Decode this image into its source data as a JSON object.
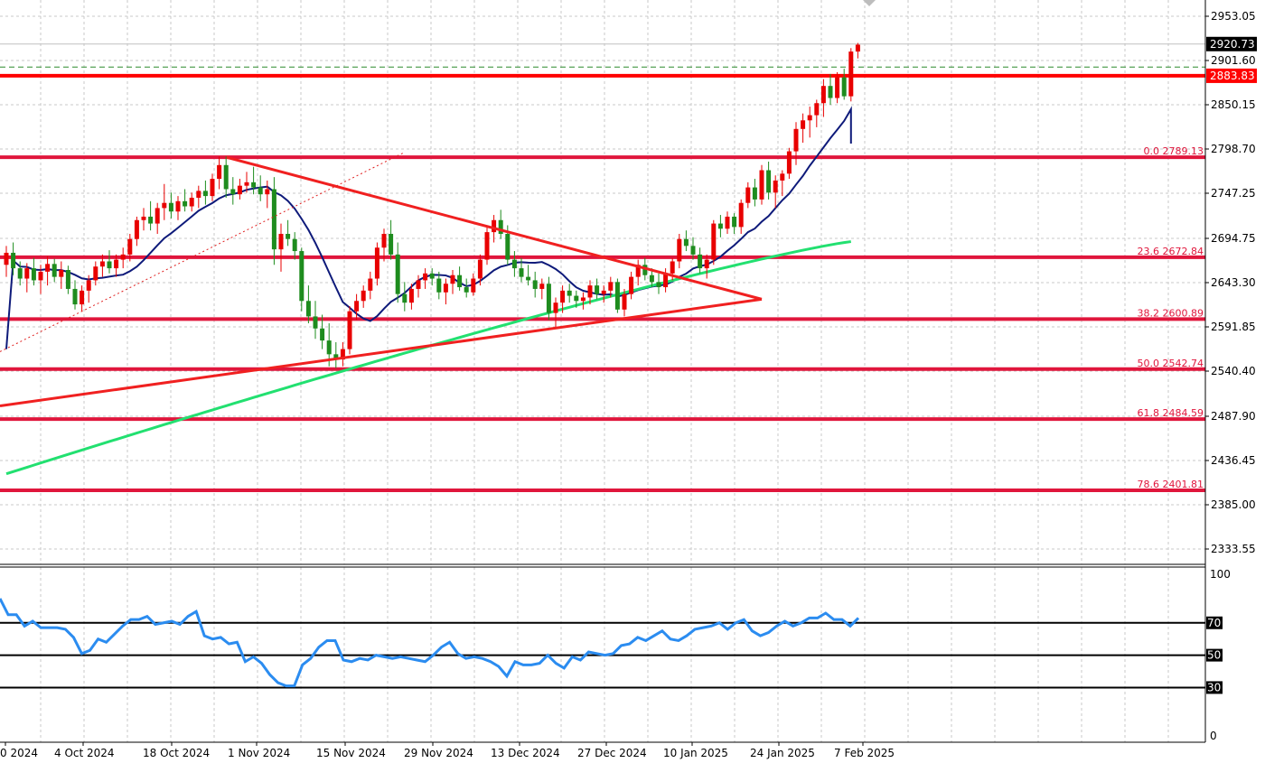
{
  "colors": {
    "background": "#ffffff",
    "grid": "#c8c8c8",
    "bull_candle": "#e80000",
    "bear_candle": "#1e8c1e",
    "fib_line": "#e0163c",
    "level_line": "#ff0000",
    "trend_line": "#f02020",
    "ma_fast": "#0e1a7a",
    "ma_slow": "#22e070",
    "rsi_line": "#2b8cf0",
    "rsi_level": "#000000"
  },
  "chart_data": [
    {
      "type": "candlestick",
      "title": "",
      "price_axis": {
        "ticks": [
          "2953.05",
          "2901.60",
          "2850.15",
          "2798.70",
          "2747.25",
          "2694.75",
          "2643.30",
          "2591.85",
          "2540.40",
          "2487.90",
          "2436.45",
          "2385.00",
          "2333.55"
        ],
        "range": [
          2322,
          2968
        ]
      },
      "time_axis": {
        "ticks": [
          "0 2024",
          "4 Oct 2024",
          "18 Oct 2024",
          "1 Nov 2024",
          "15 Nov 2024",
          "29 Nov 2024",
          "13 Dec 2024",
          "27 Dec 2024",
          "10 Jan 2025",
          "24 Jan 2025",
          "7 Feb 2025"
        ]
      },
      "current_price": {
        "label": "2920.73",
        "value": 2920.73
      },
      "ask_price": {
        "value": 2894
      },
      "horizontal_level": {
        "label": "2883.83",
        "value": 2883.83
      },
      "fibonacci_levels": [
        {
          "label": "0.0 2789.13",
          "value": 2789.13
        },
        {
          "label": "23.6 2672.84",
          "value": 2672.84
        },
        {
          "label": "38.2 2600.89",
          "value": 2600.89
        },
        {
          "label": "50.0 2542.74",
          "value": 2542.74
        },
        {
          "label": "61.8 2484.59",
          "value": 2484.59
        },
        {
          "label": "78.6 2401.81",
          "value": 2401.81
        }
      ],
      "trendlines": [
        {
          "from": [
            0,
            2500
          ],
          "to": [
            110,
            2624
          ]
        },
        {
          "from": [
            33,
            2789
          ],
          "to": [
            110,
            2624
          ]
        }
      ],
      "candles": [
        [
          2664,
          2686,
          2650,
          2678
        ],
        [
          2678,
          2690,
          2652,
          2660
        ],
        [
          2660,
          2668,
          2640,
          2648
        ],
        [
          2648,
          2666,
          2632,
          2660
        ],
        [
          2660,
          2672,
          2640,
          2646
        ],
        [
          2646,
          2664,
          2630,
          2656
        ],
        [
          2656,
          2674,
          2640,
          2665
        ],
        [
          2665,
          2671,
          2644,
          2650
        ],
        [
          2650,
          2668,
          2636,
          2658
        ],
        [
          2658,
          2663,
          2630,
          2636
        ],
        [
          2636,
          2646,
          2612,
          2618
        ],
        [
          2618,
          2640,
          2610,
          2634
        ],
        [
          2634,
          2652,
          2620,
          2646
        ],
        [
          2646,
          2668,
          2640,
          2662
        ],
        [
          2662,
          2676,
          2650,
          2668
        ],
        [
          2668,
          2681,
          2654,
          2660
        ],
        [
          2660,
          2676,
          2650,
          2670
        ],
        [
          2670,
          2684,
          2660,
          2676
        ],
        [
          2676,
          2700,
          2668,
          2694
        ],
        [
          2694,
          2720,
          2686,
          2716
        ],
        [
          2716,
          2730,
          2704,
          2720
        ],
        [
          2720,
          2738,
          2704,
          2712
        ],
        [
          2712,
          2736,
          2700,
          2730
        ],
        [
          2730,
          2758,
          2716,
          2736
        ],
        [
          2736,
          2748,
          2718,
          2726
        ],
        [
          2726,
          2744,
          2716,
          2738
        ],
        [
          2738,
          2752,
          2726,
          2732
        ],
        [
          2732,
          2748,
          2726,
          2742
        ],
        [
          2742,
          2756,
          2730,
          2750
        ],
        [
          2750,
          2762,
          2734,
          2744
        ],
        [
          2744,
          2770,
          2738,
          2764
        ],
        [
          2764,
          2790,
          2752,
          2780
        ],
        [
          2780,
          2790,
          2742,
          2752
        ],
        [
          2752,
          2766,
          2734,
          2746
        ],
        [
          2746,
          2764,
          2740,
          2756
        ],
        [
          2756,
          2772,
          2748,
          2760
        ],
        [
          2760,
          2778,
          2746,
          2754
        ],
        [
          2754,
          2768,
          2738,
          2746
        ],
        [
          2746,
          2762,
          2730,
          2752
        ],
        [
          2752,
          2766,
          2664,
          2682
        ],
        [
          2682,
          2712,
          2656,
          2700
        ],
        [
          2700,
          2716,
          2686,
          2694
        ],
        [
          2694,
          2702,
          2670,
          2680
        ],
        [
          2680,
          2684,
          2610,
          2622
        ],
        [
          2622,
          2640,
          2596,
          2604
        ],
        [
          2604,
          2622,
          2578,
          2590
        ],
        [
          2590,
          2606,
          2566,
          2576
        ],
        [
          2576,
          2596,
          2546,
          2560
        ],
        [
          2560,
          2574,
          2544,
          2554
        ],
        [
          2554,
          2574,
          2546,
          2566
        ],
        [
          2566,
          2616,
          2560,
          2610
        ],
        [
          2610,
          2630,
          2600,
          2622
        ],
        [
          2622,
          2640,
          2614,
          2634
        ],
        [
          2634,
          2656,
          2624,
          2648
        ],
        [
          2648,
          2690,
          2640,
          2684
        ],
        [
          2684,
          2706,
          2668,
          2700
        ],
        [
          2700,
          2716,
          2670,
          2676
        ],
        [
          2676,
          2690,
          2620,
          2630
        ],
        [
          2630,
          2644,
          2610,
          2620
        ],
        [
          2620,
          2642,
          2612,
          2636
        ],
        [
          2636,
          2652,
          2626,
          2646
        ],
        [
          2646,
          2660,
          2636,
          2654
        ],
        [
          2654,
          2660,
          2640,
          2648
        ],
        [
          2648,
          2656,
          2624,
          2632
        ],
        [
          2632,
          2648,
          2618,
          2642
        ],
        [
          2642,
          2658,
          2630,
          2652
        ],
        [
          2652,
          2662,
          2634,
          2638
        ],
        [
          2638,
          2648,
          2626,
          2632
        ],
        [
          2632,
          2654,
          2628,
          2648
        ],
        [
          2648,
          2676,
          2640,
          2670
        ],
        [
          2670,
          2708,
          2664,
          2702
        ],
        [
          2702,
          2722,
          2690,
          2716
        ],
        [
          2716,
          2728,
          2694,
          2700
        ],
        [
          2700,
          2710,
          2664,
          2670
        ],
        [
          2670,
          2680,
          2650,
          2660
        ],
        [
          2660,
          2672,
          2644,
          2650
        ],
        [
          2650,
          2664,
          2640,
          2646
        ],
        [
          2646,
          2656,
          2626,
          2636
        ],
        [
          2636,
          2648,
          2624,
          2642
        ],
        [
          2642,
          2650,
          2600,
          2608
        ],
        [
          2608,
          2626,
          2590,
          2620
        ],
        [
          2620,
          2640,
          2608,
          2634
        ],
        [
          2634,
          2642,
          2620,
          2628
        ],
        [
          2628,
          2634,
          2614,
          2622
        ],
        [
          2622,
          2632,
          2612,
          2626
        ],
        [
          2626,
          2646,
          2618,
          2640
        ],
        [
          2640,
          2648,
          2624,
          2630
        ],
        [
          2630,
          2640,
          2620,
          2634
        ],
        [
          2634,
          2650,
          2626,
          2644
        ],
        [
          2644,
          2648,
          2608,
          2612
        ],
        [
          2612,
          2636,
          2604,
          2630
        ],
        [
          2630,
          2656,
          2624,
          2650
        ],
        [
          2650,
          2670,
          2640,
          2664
        ],
        [
          2664,
          2672,
          2646,
          2652
        ],
        [
          2652,
          2660,
          2638,
          2644
        ],
        [
          2644,
          2654,
          2630,
          2638
        ],
        [
          2638,
          2660,
          2632,
          2654
        ],
        [
          2654,
          2672,
          2646,
          2668
        ],
        [
          2668,
          2700,
          2660,
          2694
        ],
        [
          2694,
          2704,
          2680,
          2686
        ],
        [
          2686,
          2696,
          2670,
          2676
        ],
        [
          2676,
          2684,
          2654,
          2660
        ],
        [
          2660,
          2676,
          2648,
          2670
        ],
        [
          2670,
          2716,
          2664,
          2712
        ],
        [
          2712,
          2722,
          2696,
          2706
        ],
        [
          2706,
          2726,
          2700,
          2720
        ],
        [
          2720,
          2724,
          2700,
          2708
        ],
        [
          2708,
          2740,
          2700,
          2736
        ],
        [
          2736,
          2760,
          2730,
          2754
        ],
        [
          2754,
          2764,
          2732,
          2740
        ],
        [
          2740,
          2780,
          2734,
          2774
        ],
        [
          2774,
          2784,
          2740,
          2748
        ],
        [
          2748,
          2768,
          2730,
          2762
        ],
        [
          2762,
          2774,
          2744,
          2770
        ],
        [
          2770,
          2800,
          2764,
          2796
        ],
        [
          2796,
          2830,
          2780,
          2822
        ],
        [
          2822,
          2840,
          2806,
          2832
        ],
        [
          2832,
          2848,
          2812,
          2838
        ],
        [
          2838,
          2856,
          2824,
          2852
        ],
        [
          2852,
          2880,
          2836,
          2872
        ],
        [
          2872,
          2886,
          2850,
          2858
        ],
        [
          2858,
          2888,
          2852,
          2882
        ],
        [
          2882,
          2892,
          2856,
          2860
        ],
        [
          2860,
          2916,
          2854,
          2912
        ],
        [
          2912,
          2922,
          2904,
          2920
        ]
      ],
      "ma_fast": {
        "from": [
          0,
          2566
        ],
        "to": [
          123,
          2805
        ]
      },
      "ma_slow": {
        "from": [
          0,
          2421
        ],
        "to": [
          123,
          2691
        ]
      }
    },
    {
      "type": "line",
      "title": "",
      "axis": {
        "ticks": [
          "100",
          "70",
          "50",
          "30",
          "0"
        ],
        "range": [
          0,
          100
        ]
      },
      "levels": [
        70,
        50,
        30
      ],
      "rsi": [
        85,
        75,
        75,
        68,
        71,
        67,
        67,
        67,
        66,
        61,
        51,
        53,
        60,
        58,
        63,
        68,
        72,
        72,
        74,
        69,
        70,
        71,
        69,
        74,
        77,
        62,
        60,
        61,
        57,
        58,
        46,
        49,
        45,
        38,
        33,
        31,
        31,
        44,
        48,
        55,
        59,
        59,
        47,
        46,
        48,
        47,
        50,
        49,
        48,
        49,
        48,
        47,
        46,
        50,
        55,
        58,
        51,
        48,
        49,
        48,
        46,
        43,
        37,
        46,
        44,
        44,
        45,
        50,
        45,
        42,
        49,
        47,
        52,
        51,
        50,
        51,
        56,
        57,
        61,
        59,
        62,
        65,
        60,
        59,
        62,
        66,
        67,
        68,
        70,
        66,
        70,
        72,
        65,
        62,
        64,
        68,
        71,
        68,
        70,
        73,
        73,
        76,
        72,
        72,
        68,
        73
      ]
    }
  ]
}
